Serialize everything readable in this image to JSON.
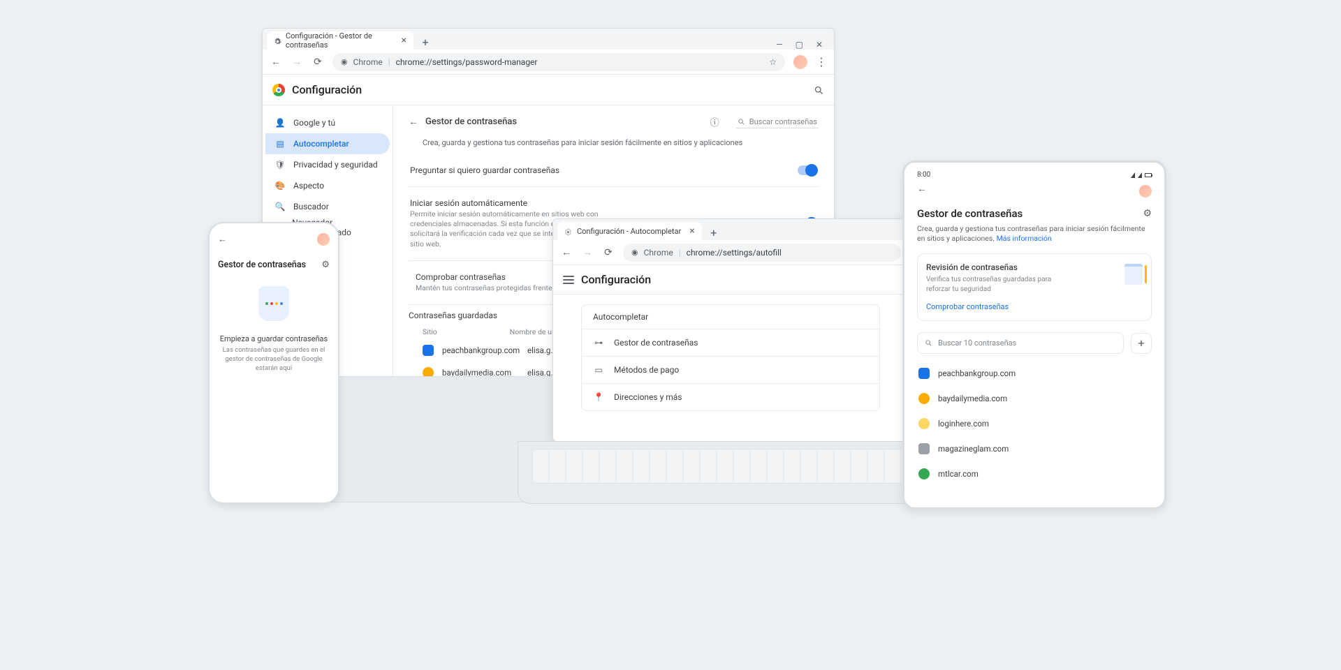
{
  "desktop": {
    "tab_title": "Configuración - Gestor de contraseñas",
    "omnibox": {
      "label": "Chrome",
      "url": "chrome://settings/password-manager"
    },
    "settings_title": "Configuración",
    "nav": [
      {
        "icon": "person",
        "label": "Google y tú"
      },
      {
        "icon": "autofill",
        "label": "Autocompletar"
      },
      {
        "icon": "shield",
        "label": "Privacidad y seguridad"
      },
      {
        "icon": "paint",
        "label": "Aspecto"
      },
      {
        "icon": "search",
        "label": "Buscador"
      },
      {
        "icon": "browser",
        "label": "Navegador predeterminado"
      }
    ],
    "content": {
      "title": "Gestor de contraseñas",
      "search_placeholder": "Buscar contraseñas",
      "desc": "Crea, guarda y gestiona tus contraseñas para iniciar sesión fácilmente en sitios y aplicaciones",
      "rows": [
        {
          "label": "Preguntar si quiero guardar contraseñas",
          "sub": "",
          "toggle": true
        },
        {
          "label": "Iniciar sesión automáticamente",
          "sub": "Permite iniciar sesión automáticamente en sitios web con credenciales almacenadas. Si esta función está desactivada, se solicitará la verificación cada vez que se intente iniciar sesión en un sitio web.",
          "toggle": true
        }
      ],
      "check": {
        "title": "Comprobar contraseñas",
        "desc": "Mantén tus contraseñas protegidas frente a quiebras"
      },
      "saved_h": "Contraseñas guardadas",
      "cols": {
        "site": "Sitio",
        "user": "Nombre de usu"
      },
      "saved": [
        {
          "site": "peachbankgroup.com",
          "user": "elisa.g.becket@",
          "style": "s-blue"
        },
        {
          "site": "baydailymedia.com",
          "user": "elisa.g.becket@",
          "style": "s-orange"
        }
      ]
    }
  },
  "laptop": {
    "tab_title": "Configuración - Autocompletar",
    "omnibox": {
      "label": "Chrome",
      "url": "chrome://settings/autofill"
    },
    "settings_title": "Configuración",
    "card_title": "Autocompletar",
    "items": [
      {
        "icon": "key",
        "label": "Gestor de contraseñas"
      },
      {
        "icon": "card",
        "label": "Métodos de pago"
      },
      {
        "icon": "pin",
        "label": "Direcciones y más"
      }
    ]
  },
  "phone": {
    "title": "Gestor de contraseñas",
    "heading": "Empieza a guardar contraseñas",
    "body": "Las contraseñas que guardes en el gestor de contraseñas de Google estarán aquí"
  },
  "tablet": {
    "time": "8:00",
    "title": "Gestor de contraseñas",
    "desc": "Crea, guarda y gestiona tus contraseñas para iniciar sesión fácilmente en sitios y aplicaciones.",
    "more": "Más información",
    "card": {
      "title": "Revisión de contraseñas",
      "desc": "Verifica tus contraseñas guardadas para reforzar tu seguridad",
      "link": "Comprobar contraseñas"
    },
    "search_placeholder": "Buscar 10 contraseñas",
    "list": [
      {
        "site": "peachbankgroup.com",
        "style": "f-blue"
      },
      {
        "site": "baydailymedia.com",
        "style": "f-orange"
      },
      {
        "site": "loginhere.com",
        "style": "f-yellow"
      },
      {
        "site": "magazineglam.com",
        "style": "f-grey"
      },
      {
        "site": "mtlcar.com",
        "style": "f-green"
      }
    ]
  }
}
